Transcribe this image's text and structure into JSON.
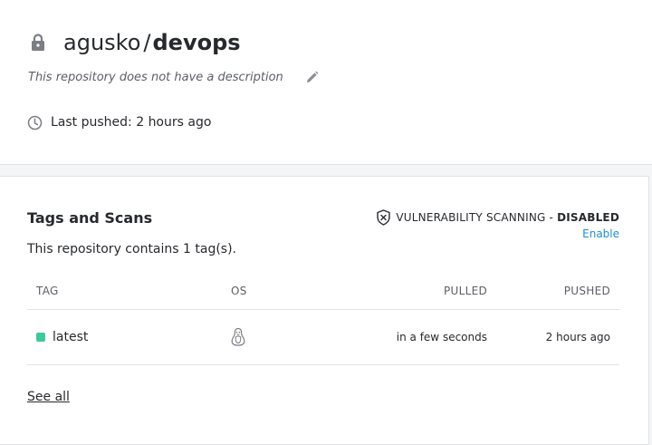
{
  "repo": {
    "namespace": "agusko",
    "separator": "/",
    "name": "devops",
    "description": "This repository does not have a description",
    "last_pushed": "Last pushed: 2 hours ago"
  },
  "tags_card": {
    "title": "Tags and Scans",
    "tag_count_text": "This repository contains 1 tag(s).",
    "vuln_label": "VULNERABILITY SCANNING - ",
    "vuln_status": "DISABLED",
    "enable_label": "Enable",
    "columns": {
      "tag": "TAG",
      "os": "OS",
      "pulled": "PULLED",
      "pushed": "PUSHED"
    },
    "rows": [
      {
        "tag": "latest",
        "os_icon": "linux-icon",
        "pulled": "in a few seconds",
        "pushed": "2 hours ago",
        "status_color": "#3ec99b"
      }
    ],
    "see_all_label": "See all"
  },
  "icons": {
    "lock": "lock-icon",
    "edit": "pencil-icon",
    "clock": "clock-icon",
    "shield": "shield-x-icon"
  },
  "colors": {
    "link": "#1d8fcf",
    "status_ok": "#3ec99b",
    "text": "#27292d",
    "muted": "#5c5f66"
  }
}
